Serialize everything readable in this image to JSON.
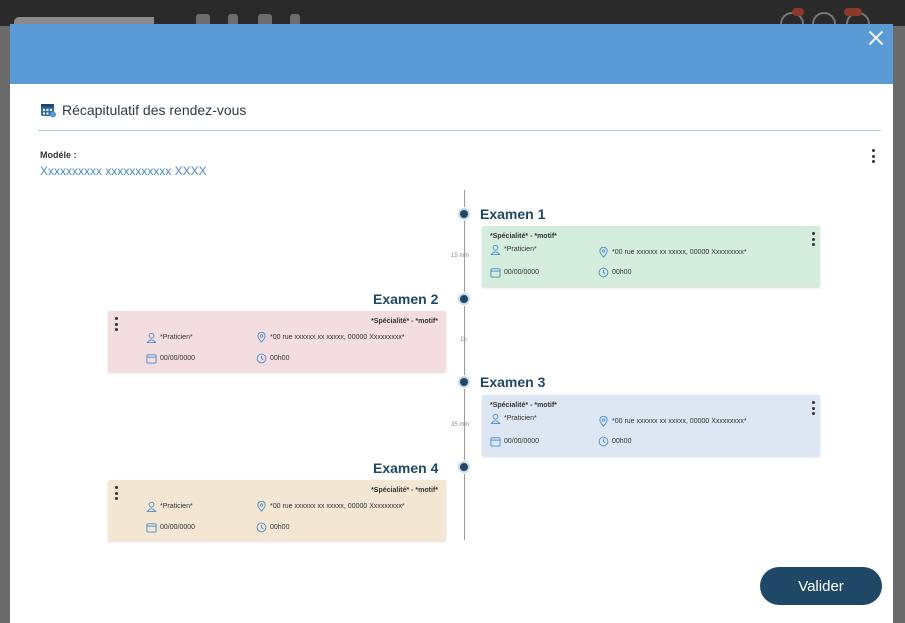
{
  "modal": {
    "close_label": "×",
    "section_title": "Récapitulatif des rendez-vous",
    "model_label": "Modéle :",
    "model_value": "Xxxxxxxxxx xxxxxxxxxxx XXXX",
    "submit_label": "Valider"
  },
  "exams": [
    {
      "title": "Examen 1",
      "specialty": "*Spécialité* - *motif*",
      "practitioner": "*Praticien*",
      "address": "*00 rue xxxxxx xx xxxxx, 00000 Xxxxxxxxx*",
      "date": "00/00/0000",
      "time": "00h00",
      "color": "#d4eddd"
    },
    {
      "title": "Examen 2",
      "specialty": "*Spécialité* - *motif*",
      "practitioner": "*Praticien*",
      "address": "*00 rue xxxxxx xx xxxxx, 00000 Xxxxxxxxx*",
      "date": "00/00/0000",
      "time": "00h00",
      "color": "#f4dde1"
    },
    {
      "title": "Examen 3",
      "specialty": "*Spécialité* - *motif*",
      "practitioner": "*Praticien*",
      "address": "*00 rue xxxxxx xx xxxxx, 00000 Xxxxxxxxx*",
      "date": "00/00/0000",
      "time": "00h00",
      "color": "#dde7f3"
    },
    {
      "title": "Examen 4",
      "specialty": "*Spécialité* - *motif*",
      "practitioner": "*Praticien*",
      "address": "*00 rue xxxxxx xx xxxxx, 00000 Xxxxxxxxx*",
      "date": "00/00/0000",
      "time": "00h00",
      "color": "#f3e6d2"
    }
  ],
  "durations": [
    "15 min",
    "1h",
    "35 min"
  ],
  "colors": {
    "header": "#5b9bd5",
    "primary": "#1f4866",
    "link": "#4a8bc9"
  }
}
